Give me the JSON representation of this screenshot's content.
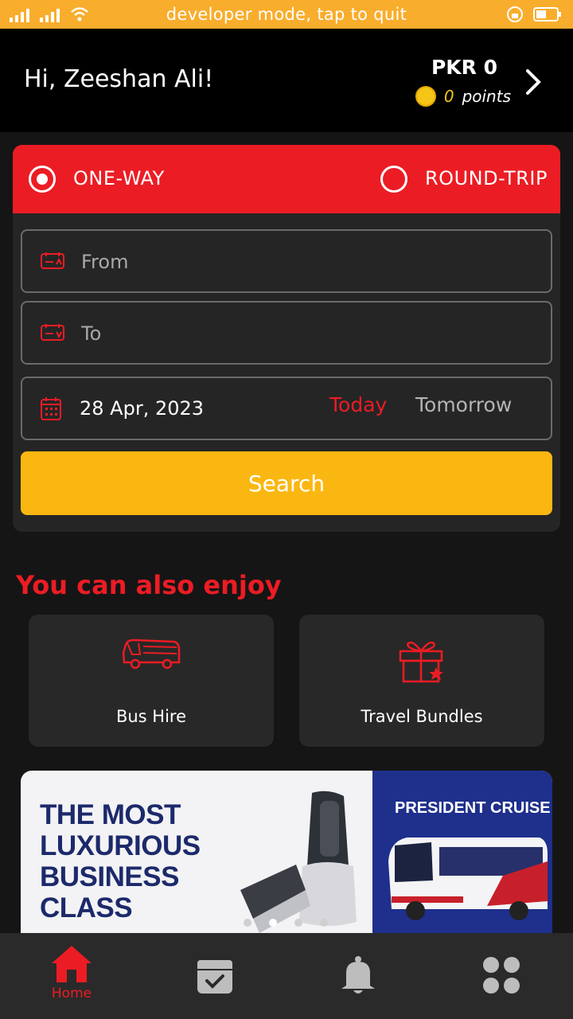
{
  "status_bar": {
    "message": "developer mode, tap to quit"
  },
  "header": {
    "greeting": "Hi, Zeeshan Ali!",
    "balance": "PKR 0",
    "points_value": "0",
    "points_label": "points"
  },
  "booking": {
    "trip_types": [
      {
        "label": "ONE-WAY",
        "selected": true
      },
      {
        "label": "ROUND-TRIP",
        "selected": false
      }
    ],
    "from_placeholder": "From",
    "to_placeholder": "To",
    "date": "28 Apr, 2023",
    "today_label": "Today",
    "tomorrow_label": "Tomorrow",
    "search_label": "Search"
  },
  "services": {
    "title": "You can also enjoy",
    "items": [
      {
        "label": "Bus Hire",
        "icon": "bus-icon"
      },
      {
        "label": "Travel Bundles",
        "icon": "gift-icon"
      }
    ]
  },
  "banner": {
    "headline_lines": [
      "THE MOST",
      "LUXURIOUS",
      "BUSINESS",
      "CLASS"
    ],
    "right_title": "PRESIDENT CRUISE",
    "slide_count": 4,
    "active_slide": 2
  },
  "bottom_nav": {
    "items": [
      {
        "label": "Home",
        "icon": "home-icon",
        "active": true
      },
      {
        "label": "",
        "icon": "bookings-icon",
        "active": false
      },
      {
        "label": "",
        "icon": "bell-icon",
        "active": false
      },
      {
        "label": "",
        "icon": "menu-grid-icon",
        "active": false
      }
    ]
  },
  "colors": {
    "accent_red": "#ec1c24",
    "accent_yellow": "#fbb711",
    "status_bar": "#f9ad2c",
    "background": "#151515"
  }
}
